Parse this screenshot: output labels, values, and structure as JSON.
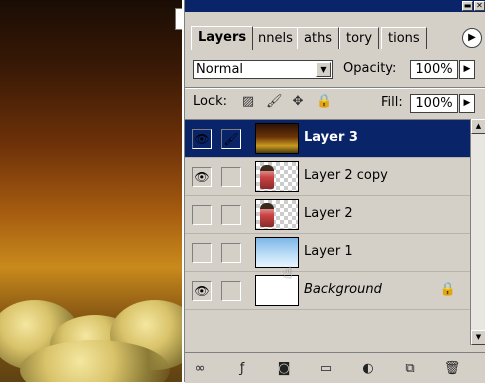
{
  "panel": {
    "tabs": [
      {
        "label": "Layers",
        "active": true
      },
      {
        "label": "nnels",
        "active": false
      },
      {
        "label": "aths",
        "active": false
      },
      {
        "label": "tory",
        "active": false
      },
      {
        "label": "tions",
        "active": false
      }
    ],
    "titlebar_buttons": {
      "minimize": "▬",
      "close": "✕"
    },
    "tab_menu_icon": "▶",
    "blend_mode": "Normal",
    "opacity_label": "Opacity:",
    "opacity_value": "100%",
    "lock_label": "Lock:",
    "fill_label": "Fill:",
    "fill_value": "100%"
  },
  "layers": [
    {
      "name": "Layer 3",
      "visible": true,
      "linked": true,
      "selected": true,
      "thumb": "sunset"
    },
    {
      "name": "Layer 2 copy",
      "visible": true,
      "linked": false,
      "selected": false,
      "thumb": "figure"
    },
    {
      "name": "Layer 2",
      "visible": false,
      "linked": false,
      "selected": false,
      "thumb": "figure"
    },
    {
      "name": "Layer 1",
      "visible": false,
      "linked": false,
      "selected": false,
      "thumb": "sky"
    },
    {
      "name": "Background",
      "visible": true,
      "linked": false,
      "selected": false,
      "thumb": "white",
      "locked": true
    }
  ],
  "icons": {
    "eye": "👁",
    "brush": "🖌",
    "lock": "🔒",
    "checker_lock": "▨",
    "move": "✥",
    "dropdown": "▼",
    "arrow_right": "▶",
    "scroll_up": "▲",
    "scroll_down": "▼",
    "hand": "☝"
  },
  "bottom_buttons": [
    "link-layers",
    "add-layer-style",
    "add-mask",
    "new-group",
    "new-adjustment",
    "new-layer",
    "delete-layer"
  ],
  "bottom_glyphs": {
    "link-layers": "∞",
    "add-layer-style": "ƒ",
    "add-mask": "◙",
    "new-group": "▭",
    "new-adjustment": "◐",
    "new-layer": "⧉",
    "delete-layer": "🗑"
  },
  "colors": {
    "selected_row": "#0a246a",
    "panel": "#d4d0c8"
  }
}
